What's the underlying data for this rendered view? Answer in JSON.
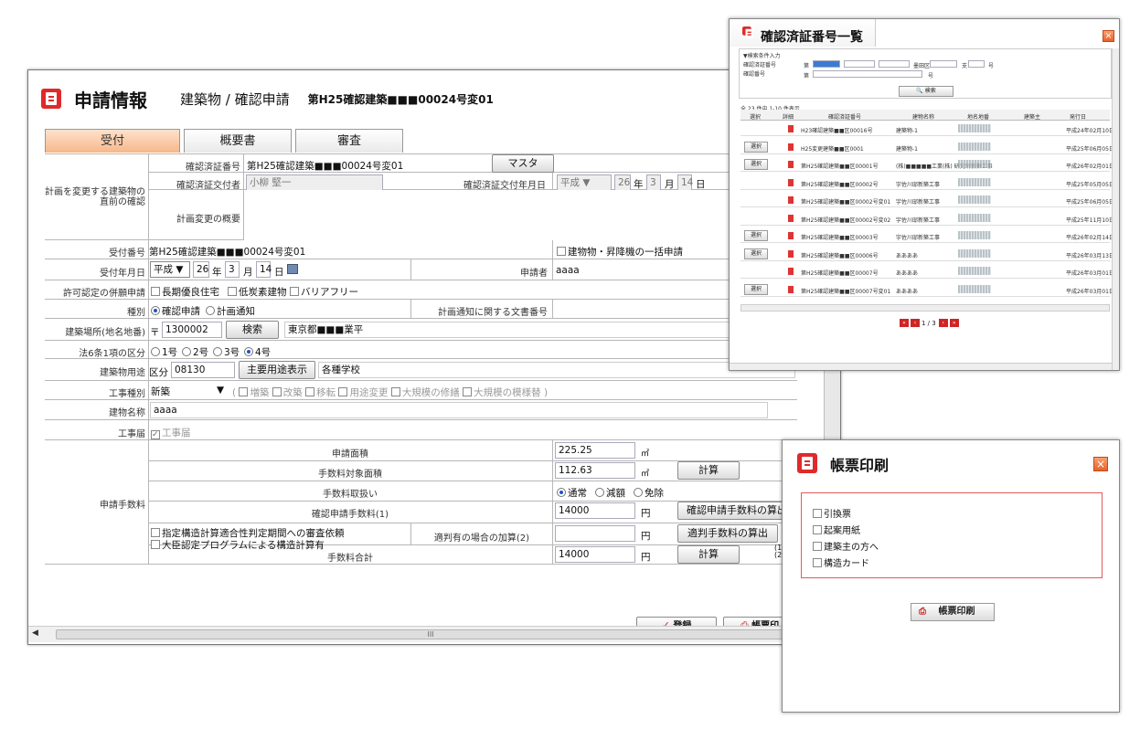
{
  "main": {
    "title": "申請情報",
    "subtitle": "建築物 / 確認申請",
    "doc_no": "第H25確認建築■■■00024号変01",
    "tabs": [
      "受付",
      "概要書",
      "審査"
    ],
    "group_label": "計画を変更する建築物の直前の確認",
    "cert_no_label": "確認済証番号",
    "cert_no_value": "第H25確認建築■■■00024号変01",
    "master_btn": "マスタ",
    "issuer_label": "確認済証交付者",
    "issuer_value": "小柳 堅一",
    "issue_date_label": "確認済証交付年月日",
    "issue_era": "平成",
    "issue_year": "26",
    "issue_month": "3",
    "issue_day": "14",
    "summary_label": "計画変更の概要",
    "reception_no_label": "受付番号",
    "reception_no_value": "第H25確認建築■■■00024号変01",
    "bulk_label": "建物物・昇降機の一括申請",
    "reception_date_label": "受付年月日",
    "rec_era": "平成",
    "rec_year": "26",
    "rec_month": "3",
    "rec_day": "14",
    "applicant_label": "申請者",
    "applicant_value": "aaaa",
    "permit_label": "許可認定の併願申請",
    "permit_opts": [
      "長期優良住宅",
      "低炭素建物",
      "バリアフリー"
    ],
    "kind_label": "種別",
    "kind_opts": [
      "確認申請",
      "計画通知"
    ],
    "notice_label": "計画通知に関する文書番号",
    "location_label": "建築場所(地名地番)",
    "zip_mark": "〒",
    "zip_value": "1300002",
    "search_btn": "検索",
    "address_value": "東京都■■■業平",
    "art6_label": "法6条1項の区分",
    "art6_opts": [
      "1号",
      "2号",
      "3号",
      "4号"
    ],
    "use_label": "建築物用途",
    "use_kubun": "区分",
    "use_code": "08130",
    "use_btn": "主要用途表示",
    "use_value": "各種学校",
    "work_label": "工事種別",
    "work_value": "新築",
    "work_opts": [
      "増築",
      "改築",
      "移転",
      "用途変更",
      "大規模の修繕",
      "大規模の模様替"
    ],
    "name_label": "建物名称",
    "name_value": "aaaa",
    "kouji_label": "工事届",
    "kouji_value": "工事届",
    "fee_group_label": "申請手数料",
    "area_label": "申請面積",
    "area_value": "225.25",
    "area_unit": "㎡",
    "fee_area_label": "手数料対象面積",
    "fee_area_value": "112.63",
    "calc_btn": "計算",
    "handling_label": "手数料取扱い",
    "handling_opts": [
      "通常",
      "減額",
      "免除"
    ],
    "fee1_label": "確認申請手数料(1)",
    "fee1_value": "14000",
    "yen": "円",
    "fee1_btn": "確認申請手数料の算出",
    "check1": "指定構造計算適合性判定期間への審査依頼",
    "check2": "大臣認定プログラムによる構造計算有",
    "fee2_label": "適判有の場合の加算(2)",
    "fee2_btn": "適判手数料の算出",
    "total_label": "手数料合計",
    "total_value": "14000",
    "total_note1": "(1)",
    "total_note2": "(2)",
    "register_btn": "登録",
    "print_btn": "帳票印",
    "scroll_mark": "III"
  },
  "popup1": {
    "title": "確認済証番号一覧",
    "search_heading": "▼検索条件入力",
    "f1_label": "確認済証番号",
    "f2_label": "確認番号",
    "dai": "第",
    "ward": "墨田区",
    "shi": "支",
    "go": "号",
    "search_btn": "検索",
    "result_count": "全 23 件中 1-10 件表示",
    "headers": [
      "選択",
      "詳細",
      "確認済証番号",
      "建物名称",
      "地名地番",
      "建築主",
      "発行日"
    ],
    "select_label": "選択",
    "rows": [
      {
        "select": false,
        "no": "H23確認建築■■区00016号",
        "name": "建築物-1",
        "date": "平成24年02月10日"
      },
      {
        "select": true,
        "no": "H25変更建築■■区0001",
        "name": "建築物-1",
        "date": "平成25年06月05日"
      },
      {
        "select": true,
        "no": "第H25確認建築■■区00001号",
        "name": "(株)■■■■■工業(株) 研究所新築工事",
        "date": "平成26年02月01日"
      },
      {
        "select": false,
        "no": "第H25確認建築■■区00002号",
        "name": "宇佐川邸新築工事",
        "date": "平成25年05月05日"
      },
      {
        "select": false,
        "no": "第H25確認建築■■区00002号変01",
        "name": "宇佐川邸新築工事",
        "date": "平成25年06月05日"
      },
      {
        "select": false,
        "no": "第H25確認建築■■区00002号変02",
        "name": "宇佐川邸新築工事",
        "date": "平成25年11月10日"
      },
      {
        "select": true,
        "no": "第H25確認建築■■区00003号",
        "name": "宇佐川邸新築工事",
        "date": "平成26年02月14日"
      },
      {
        "select": true,
        "no": "第H25確認建築■■区00006号",
        "name": "ああああ",
        "date": "平成26年03月13日"
      },
      {
        "select": false,
        "no": "第H25確認建築■■区00007号",
        "name": "ああああ",
        "date": "平成26年03月01日"
      },
      {
        "select": true,
        "no": "第H25確認建築■■区00007号変01",
        "name": "ああああ",
        "date": "平成26年03月01日"
      }
    ],
    "pager_text": "1 / 3"
  },
  "popup2": {
    "title": "帳票印刷",
    "options": [
      "引換票",
      "起案用紙",
      "建築主の方へ",
      "構造カード"
    ],
    "print_btn": "帳票印刷"
  }
}
